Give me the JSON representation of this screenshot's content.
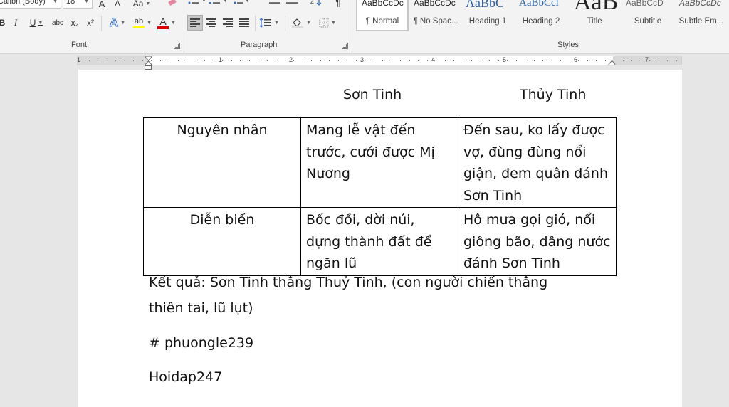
{
  "ribbon": {
    "font": {
      "name": "Calibri (Body)",
      "size": "18",
      "group_label": "Font",
      "grow": "A",
      "shrink": "A",
      "case": "Aa",
      "bold": "B",
      "italic": "I",
      "underline": "U",
      "strike": "abc",
      "subscript": "x₂",
      "superscript": "x²",
      "effects": "A",
      "highlight": "ab",
      "color": "A"
    },
    "paragraph": {
      "group_label": "Paragraph"
    },
    "styles": {
      "group_label": "Styles",
      "items": [
        {
          "sample": "AaBbCcDc",
          "name": "¶ Normal"
        },
        {
          "sample": "AaBbCcDc",
          "name": "¶ No Spac..."
        },
        {
          "sample": "AaBbC",
          "name": "Heading 1"
        },
        {
          "sample": "AaBbCcl",
          "name": "Heading 2"
        },
        {
          "sample": "AaB",
          "name": "Title"
        },
        {
          "sample": "AaBbCcD",
          "name": "Subtitle"
        },
        {
          "sample": "AaBbCcDc",
          "name": "Subtle Em..."
        }
      ]
    },
    "colors": {
      "highlight": "#ffff00",
      "font_color": "#e00000",
      "effects": "#3a6fc4",
      "heading": "#2e5f9e"
    }
  },
  "ruler": {
    "numbers": [
      "1",
      "1",
      "2",
      "3",
      "4",
      "5",
      "6",
      "7"
    ]
  },
  "document": {
    "header_col2": "Sơn Tinh",
    "header_col3": "Thủy Tinh",
    "table": [
      {
        "label": "Nguyên nhân",
        "col2": "Mang lễ vật đến trước, cưới được Mị Nương",
        "col3": "Đến sau, ko lấy được vợ, đùng đùng nổi giận, đem quân đánh Sơn Tinh"
      },
      {
        "label": "Diễn biến",
        "col2": "Bốc đồi, dời núi, dựng thành đất để ngăn lũ",
        "col3": "Hô mưa gọi gió, nổi giông bão, dâng nước đánh Sơn Tinh"
      }
    ],
    "result_line1": "Kết quả: Sơn Tinh thắng Thuỷ Tinh, (con người chiến thắng",
    "result_line2": "thiên tai, lũ lụt)",
    "tag": "# phuongle239",
    "site": "Hoidap247"
  }
}
